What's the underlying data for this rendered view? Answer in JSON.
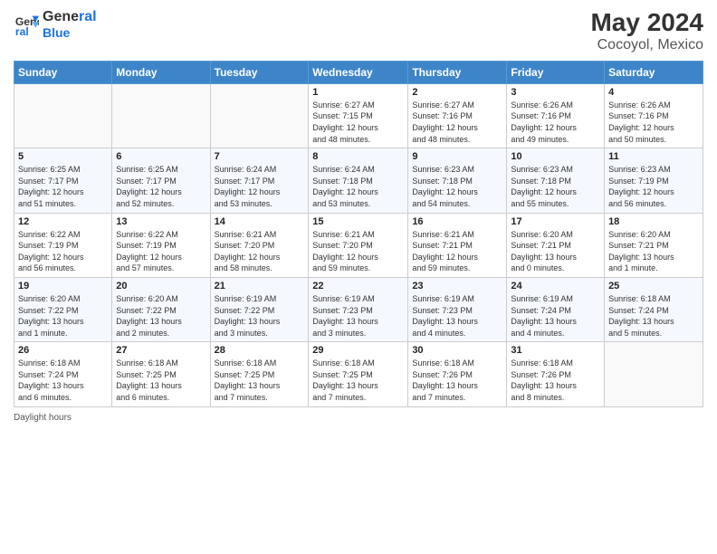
{
  "header": {
    "logo_line1": "General",
    "logo_line2": "Blue",
    "title": "May 2024",
    "subtitle": "Cocoyol, Mexico"
  },
  "calendar": {
    "days_of_week": [
      "Sunday",
      "Monday",
      "Tuesday",
      "Wednesday",
      "Thursday",
      "Friday",
      "Saturday"
    ],
    "weeks": [
      [
        {
          "day": "",
          "info": ""
        },
        {
          "day": "",
          "info": ""
        },
        {
          "day": "",
          "info": ""
        },
        {
          "day": "1",
          "info": "Sunrise: 6:27 AM\nSunset: 7:15 PM\nDaylight: 12 hours\nand 48 minutes."
        },
        {
          "day": "2",
          "info": "Sunrise: 6:27 AM\nSunset: 7:16 PM\nDaylight: 12 hours\nand 48 minutes."
        },
        {
          "day": "3",
          "info": "Sunrise: 6:26 AM\nSunset: 7:16 PM\nDaylight: 12 hours\nand 49 minutes."
        },
        {
          "day": "4",
          "info": "Sunrise: 6:26 AM\nSunset: 7:16 PM\nDaylight: 12 hours\nand 50 minutes."
        }
      ],
      [
        {
          "day": "5",
          "info": "Sunrise: 6:25 AM\nSunset: 7:17 PM\nDaylight: 12 hours\nand 51 minutes."
        },
        {
          "day": "6",
          "info": "Sunrise: 6:25 AM\nSunset: 7:17 PM\nDaylight: 12 hours\nand 52 minutes."
        },
        {
          "day": "7",
          "info": "Sunrise: 6:24 AM\nSunset: 7:17 PM\nDaylight: 12 hours\nand 53 minutes."
        },
        {
          "day": "8",
          "info": "Sunrise: 6:24 AM\nSunset: 7:18 PM\nDaylight: 12 hours\nand 53 minutes."
        },
        {
          "day": "9",
          "info": "Sunrise: 6:23 AM\nSunset: 7:18 PM\nDaylight: 12 hours\nand 54 minutes."
        },
        {
          "day": "10",
          "info": "Sunrise: 6:23 AM\nSunset: 7:18 PM\nDaylight: 12 hours\nand 55 minutes."
        },
        {
          "day": "11",
          "info": "Sunrise: 6:23 AM\nSunset: 7:19 PM\nDaylight: 12 hours\nand 56 minutes."
        }
      ],
      [
        {
          "day": "12",
          "info": "Sunrise: 6:22 AM\nSunset: 7:19 PM\nDaylight: 12 hours\nand 56 minutes."
        },
        {
          "day": "13",
          "info": "Sunrise: 6:22 AM\nSunset: 7:19 PM\nDaylight: 12 hours\nand 57 minutes."
        },
        {
          "day": "14",
          "info": "Sunrise: 6:21 AM\nSunset: 7:20 PM\nDaylight: 12 hours\nand 58 minutes."
        },
        {
          "day": "15",
          "info": "Sunrise: 6:21 AM\nSunset: 7:20 PM\nDaylight: 12 hours\nand 59 minutes."
        },
        {
          "day": "16",
          "info": "Sunrise: 6:21 AM\nSunset: 7:21 PM\nDaylight: 12 hours\nand 59 minutes."
        },
        {
          "day": "17",
          "info": "Sunrise: 6:20 AM\nSunset: 7:21 PM\nDaylight: 13 hours\nand 0 minutes."
        },
        {
          "day": "18",
          "info": "Sunrise: 6:20 AM\nSunset: 7:21 PM\nDaylight: 13 hours\nand 1 minute."
        }
      ],
      [
        {
          "day": "19",
          "info": "Sunrise: 6:20 AM\nSunset: 7:22 PM\nDaylight: 13 hours\nand 1 minute."
        },
        {
          "day": "20",
          "info": "Sunrise: 6:20 AM\nSunset: 7:22 PM\nDaylight: 13 hours\nand 2 minutes."
        },
        {
          "day": "21",
          "info": "Sunrise: 6:19 AM\nSunset: 7:22 PM\nDaylight: 13 hours\nand 3 minutes."
        },
        {
          "day": "22",
          "info": "Sunrise: 6:19 AM\nSunset: 7:23 PM\nDaylight: 13 hours\nand 3 minutes."
        },
        {
          "day": "23",
          "info": "Sunrise: 6:19 AM\nSunset: 7:23 PM\nDaylight: 13 hours\nand 4 minutes."
        },
        {
          "day": "24",
          "info": "Sunrise: 6:19 AM\nSunset: 7:24 PM\nDaylight: 13 hours\nand 4 minutes."
        },
        {
          "day": "25",
          "info": "Sunrise: 6:18 AM\nSunset: 7:24 PM\nDaylight: 13 hours\nand 5 minutes."
        }
      ],
      [
        {
          "day": "26",
          "info": "Sunrise: 6:18 AM\nSunset: 7:24 PM\nDaylight: 13 hours\nand 6 minutes."
        },
        {
          "day": "27",
          "info": "Sunrise: 6:18 AM\nSunset: 7:25 PM\nDaylight: 13 hours\nand 6 minutes."
        },
        {
          "day": "28",
          "info": "Sunrise: 6:18 AM\nSunset: 7:25 PM\nDaylight: 13 hours\nand 7 minutes."
        },
        {
          "day": "29",
          "info": "Sunrise: 6:18 AM\nSunset: 7:25 PM\nDaylight: 13 hours\nand 7 minutes."
        },
        {
          "day": "30",
          "info": "Sunrise: 6:18 AM\nSunset: 7:26 PM\nDaylight: 13 hours\nand 7 minutes."
        },
        {
          "day": "31",
          "info": "Sunrise: 6:18 AM\nSunset: 7:26 PM\nDaylight: 13 hours\nand 8 minutes."
        },
        {
          "day": "",
          "info": ""
        }
      ]
    ]
  },
  "footer": {
    "text": "Daylight hours"
  }
}
